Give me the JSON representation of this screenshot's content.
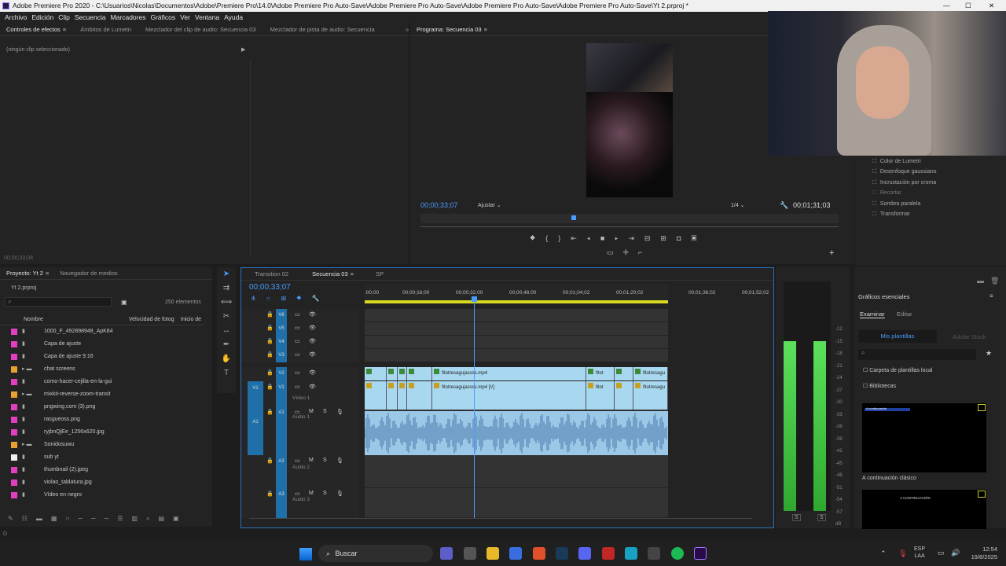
{
  "window": {
    "title": "Adobe Premiere Pro 2020 - C:\\Usuarios\\Nicolas\\Documentos\\Adobe\\Premiere Pro\\14.0\\Adobe Premiere Pro Auto-Save\\Adobe Premiere Pro Auto-Save\\Adobe Premiere Pro Auto-Save\\Adobe Premiere Pro Auto-Save\\Yt 2.prproj *"
  },
  "menu": [
    "Archivo",
    "Edición",
    "Clip",
    "Secuencia",
    "Marcadores",
    "Gráficos",
    "Ver",
    "Ventana",
    "Ayuda"
  ],
  "source_panel": {
    "tabs": [
      "Controles de efectos",
      "Ámbitos de Lumetri",
      "Mezclador del clip de audio: Secuencia 03",
      "Mezclador de pista de audio: Secuencia"
    ],
    "empty": "(ningún clip seleccionado)",
    "timecode": "00;00;33;08"
  },
  "program": {
    "tab": "Programa: Secuencia 03",
    "timecode": "00;00;33;07",
    "fit": "Ajustar",
    "quality": "1/4",
    "duration": "00;01;31;03",
    "playhead_fraction": 0.36
  },
  "effects_list": [
    "Color de Lumetri",
    "Desenfoque gaussiano",
    "Incrustación por croma",
    "Recortar",
    "Sombra paralela",
    "Transformar"
  ],
  "project": {
    "tabs": [
      "Proyecto: Yt 2",
      "Navegador de medios"
    ],
    "file": "Yt 2.prproj",
    "count": "250 elementos",
    "columns": [
      "Nombre",
      "Velocidad de fotog",
      "Inicio de"
    ],
    "items": [
      {
        "name": "1000_F_492898948_ApK84",
        "color": "#e040c0"
      },
      {
        "name": "Capa de ajuste",
        "color": "#e040c0"
      },
      {
        "name": "Capa de ajuste 9:16",
        "color": "#e040c0"
      },
      {
        "name": "chat screens",
        "color": "#e8a030"
      },
      {
        "name": "como-hacer-cejilla-en-la-gui",
        "color": "#e040c0"
      },
      {
        "name": "mixkit-reverse-zoom-transit",
        "color": "#e8a030"
      },
      {
        "name": "pngwing.com (3).png",
        "color": "#e040c0"
      },
      {
        "name": "rasgueoss.png",
        "color": "#e040c0"
      },
      {
        "name": "ryjbnQjEe_1256x620.jpg",
        "color": "#e040c0"
      },
      {
        "name": "Sonidosuwu",
        "color": "#e8a030"
      },
      {
        "name": "sub yt",
        "color": "#f0f0f0"
      },
      {
        "name": "thumbnail (2).jpeg",
        "color": "#e040c0"
      },
      {
        "name": "violao_tablatura.jpg",
        "color": "#e040c0"
      },
      {
        "name": "Vídeo en negro",
        "color": "#e040c0"
      }
    ]
  },
  "timeline": {
    "tabs": [
      "Transition 02",
      "Secuencia 03",
      "SP"
    ],
    "timecode": "00;00;33;07",
    "ruler": [
      ":00;00",
      "00;00;16;00",
      "00;00;32;00",
      "00;00;48;00",
      "00;01;04;02",
      "00;01;20;02",
      "00;01;36;02",
      "00;01;52;02"
    ],
    "tracks": [
      "V6",
      "V5",
      "V4",
      "V3",
      "V2",
      "V1",
      "A1",
      "A2",
      "A3"
    ],
    "v1_name": "Vídeo 1",
    "a1_name": "Audio 1",
    "a2_name": "Audio 2",
    "a3_name": "Audio 3",
    "clips": {
      "v2_main": "fitotresagujassss.mp4",
      "v1_main": "fitotresagujassss.mp4 [V]",
      "short1": "fitot",
      "short2": "fitotresagu"
    }
  },
  "essential": {
    "title": "Gráficos esenciales",
    "tabs": [
      "Examinar",
      "Editar"
    ],
    "sub": "Mis plantillas",
    "sub2": "Adobe Stock",
    "opt1": "Carpeta de plantillas local",
    "opt2": "Bibliotecas",
    "template1": "A continuación clásico",
    "thumb1": "A continuación",
    "thumb2": "A CONTINUACIÓN"
  },
  "meter": {
    "labels": [
      "-12",
      "-15",
      "-18",
      "-21",
      "-24",
      "-27",
      "-30",
      "-33",
      "-36",
      "-39",
      "-42",
      "-45",
      "-48",
      "-51",
      "-54",
      "-57",
      "dB"
    ],
    "s": "S",
    "level_fraction": 0.9
  },
  "taskbar": {
    "search": "Buscar",
    "lang1": "ESP",
    "lang2": "LAA",
    "time": "12:54",
    "date": "19/8/2025"
  },
  "colors": {
    "accent": "#4a9bff",
    "clip_video": "#a8d8f0",
    "audio_wave": "#7fb4dc",
    "track_blue": "#1f6fa8"
  }
}
